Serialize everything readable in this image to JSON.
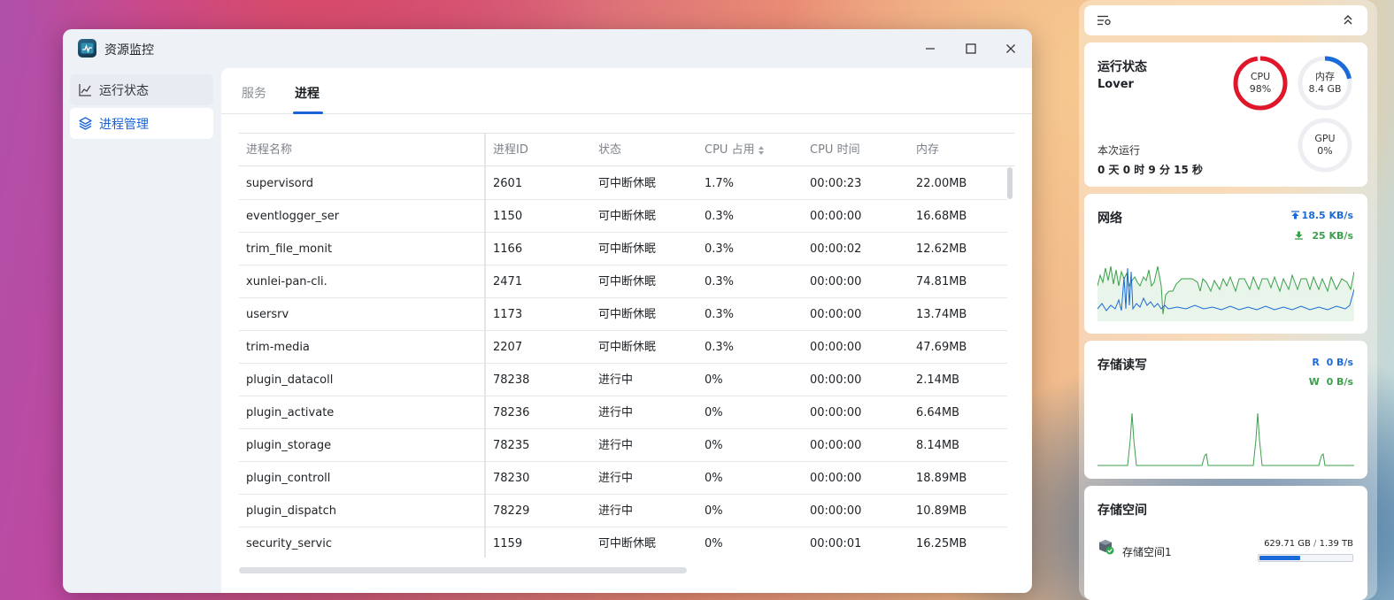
{
  "window": {
    "title": "资源监控",
    "controls": [
      "minimize-icon",
      "maximize-icon",
      "close-icon"
    ]
  },
  "sidebar": {
    "items": [
      {
        "label": "运行状态",
        "icon": "chart-line-icon",
        "active": false
      },
      {
        "label": "进程管理",
        "icon": "layers-icon",
        "active": true
      }
    ]
  },
  "tabs": [
    {
      "label": "服务",
      "active": false
    },
    {
      "label": "进程",
      "active": true
    }
  ],
  "table": {
    "columns": [
      "进程名称",
      "进程ID",
      "状态",
      "CPU 占用",
      "CPU 时间",
      "内存"
    ],
    "sorted_column": "CPU 占用",
    "rows": [
      [
        "supervisord",
        "2601",
        "可中断休眠",
        "1.7%",
        "00:00:23",
        "22.00MB"
      ],
      [
        "eventlogger_ser",
        "1150",
        "可中断休眠",
        "0.3%",
        "00:00:00",
        "16.68MB"
      ],
      [
        "trim_file_monit",
        "1166",
        "可中断休眠",
        "0.3%",
        "00:00:02",
        "12.62MB"
      ],
      [
        "xunlei-pan-cli.",
        "2471",
        "可中断休眠",
        "0.3%",
        "00:00:00",
        "74.81MB"
      ],
      [
        "usersrv",
        "1173",
        "可中断休眠",
        "0.3%",
        "00:00:00",
        "13.74MB"
      ],
      [
        "trim-media",
        "2207",
        "可中断休眠",
        "0.3%",
        "00:00:00",
        "47.69MB"
      ],
      [
        "plugin_datacoll",
        "78238",
        "进行中",
        "0%",
        "00:00:00",
        "2.14MB"
      ],
      [
        "plugin_activate",
        "78236",
        "进行中",
        "0%",
        "00:00:00",
        "6.64MB"
      ],
      [
        "plugin_storage",
        "78235",
        "进行中",
        "0%",
        "00:00:00",
        "8.14MB"
      ],
      [
        "plugin_controll",
        "78230",
        "进行中",
        "0%",
        "00:00:00",
        "18.89MB"
      ],
      [
        "plugin_dispatch",
        "78229",
        "进行中",
        "0%",
        "00:00:00",
        "10.89MB"
      ],
      [
        "security_servic",
        "1159",
        "可中断休眠",
        "0%",
        "00:00:01",
        "16.25MB"
      ]
    ]
  },
  "widgets": {
    "toolbar": {
      "left_icon": "filter-settings-icon",
      "right_icon": "double-chevron-up-icon"
    },
    "status": {
      "title": "运行状态",
      "host": "Lover",
      "uptime_label": "本次运行",
      "uptime": "0 天 0 时 9 分 15 秒",
      "cpu": {
        "label": "CPU",
        "value": "98%",
        "percent": 98,
        "color": "#e0162b"
      },
      "memory": {
        "label": "内存",
        "value": "8.4 GB",
        "percent": 22,
        "color": "#1a6ad9"
      },
      "gpu": {
        "label": "GPU",
        "value": "0%",
        "percent": 0
      }
    },
    "network": {
      "title": "网络",
      "upload": "18.5 KB/s",
      "download": "25 KB/s",
      "upload_color": "#1a6ad9",
      "download_color": "#3aa04a"
    },
    "disk_io": {
      "title": "存储读写",
      "read_label": "R",
      "read": "0 B/s",
      "write_label": "W",
      "write": "0 B/s"
    },
    "storage": {
      "title": "存储空间",
      "items": [
        {
          "name": "存储空间1",
          "used": "629.71 GB",
          "total": "1.39 TB",
          "used_fraction": 0.44
        }
      ]
    }
  }
}
